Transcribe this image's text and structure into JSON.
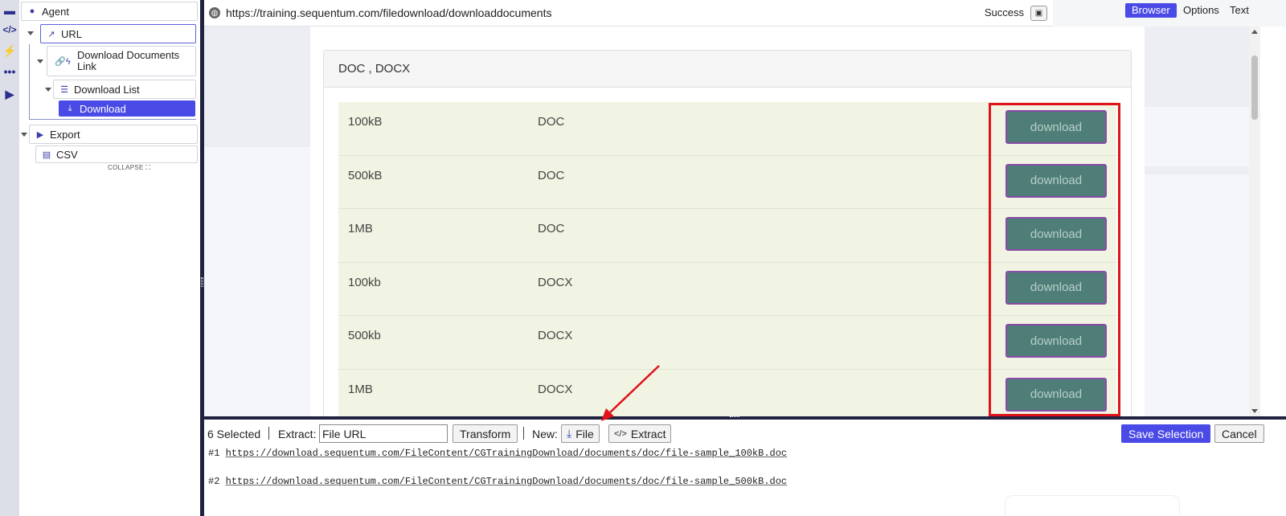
{
  "rail": {
    "icons": [
      "agent-panel-icon",
      "code-icon",
      "bolt-icon",
      "more-icon",
      "export-icon"
    ]
  },
  "tree": {
    "agent": "Agent",
    "url": "URL",
    "download_documents_link": "Download Documents Link",
    "download_list": "Download List",
    "download": "Download",
    "export": "Export",
    "csv": "CSV",
    "collapse": "COLLAPSE"
  },
  "address": {
    "url": "https://training.sequentum.com/filedownload/downloaddocuments",
    "status": "Success"
  },
  "view_tabs": {
    "browser": "Browser",
    "options": "Options",
    "text": "Text",
    "active": "Browser"
  },
  "page": {
    "card_title": "DOC , DOCX",
    "rows": [
      {
        "size": "100kB",
        "type": "DOC",
        "button": "download"
      },
      {
        "size": "500kB",
        "type": "DOC",
        "button": "download"
      },
      {
        "size": "1MB",
        "type": "DOC",
        "button": "download"
      },
      {
        "size": "100kb",
        "type": "DOCX",
        "button": "download"
      },
      {
        "size": "500kb",
        "type": "DOCX",
        "button": "download"
      },
      {
        "size": "1MB",
        "type": "DOCX",
        "button": "download"
      }
    ]
  },
  "selection": {
    "count_text": "6 Selected",
    "extract_label": "Extract:",
    "extract_value": "File URL",
    "transform": "Transform",
    "new_label": "New:",
    "file_button": "File",
    "extract_button": "Extract",
    "save_selection": "Save Selection",
    "cancel": "Cancel",
    "results": [
      {
        "index": "#1",
        "url": "https://download.sequentum.com/FileContent/CGTrainingDownload/documents/doc/file-sample_100kB.doc"
      },
      {
        "index": "#2",
        "url": "https://download.sequentum.com/FileContent/CGTrainingDownload/documents/doc/file-sample_500kB.doc"
      }
    ]
  },
  "colors": {
    "accent": "#4a4ae6",
    "highlight_box": "#e0121a",
    "download_button": "#4f7e78",
    "row_background": "#f1f4e2"
  }
}
